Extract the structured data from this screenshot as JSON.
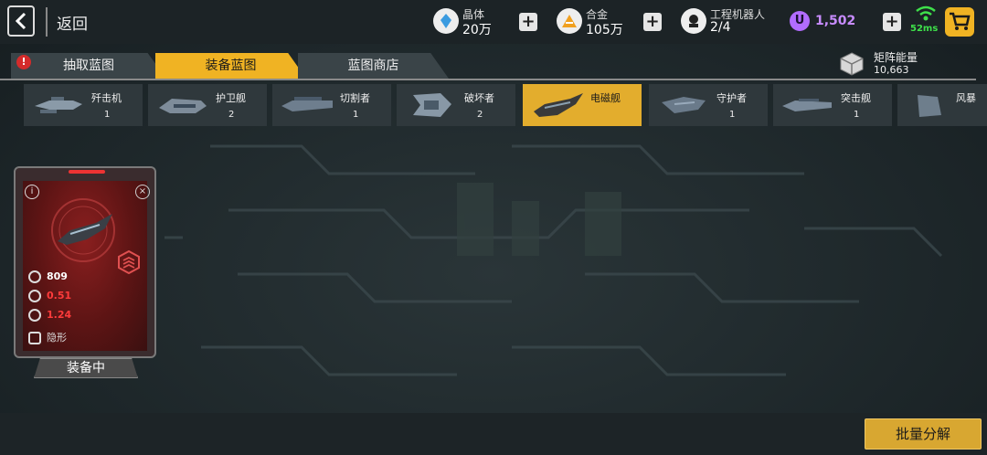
{
  "header": {
    "back_label": "返回",
    "resources": [
      {
        "label": "晶体",
        "value": "20万",
        "icon": "crystal-icon"
      },
      {
        "label": "合金",
        "value": "105万",
        "icon": "alloy-icon"
      },
      {
        "label": "工程机器人",
        "value": "2/4",
        "icon": "robot-icon"
      }
    ],
    "currency_value": "1,502",
    "network_latency": "52ms"
  },
  "tabs": [
    {
      "label": "抽取蓝图",
      "active": false,
      "alert": "!"
    },
    {
      "label": "装备蓝图",
      "active": true
    },
    {
      "label": "蓝图商店",
      "active": false
    }
  ],
  "matrix_energy": {
    "label": "矩阵能量",
    "value": "10,663"
  },
  "ships": [
    {
      "name": "歼击机",
      "count": "1"
    },
    {
      "name": "护卫舰",
      "count": "2"
    },
    {
      "name": "切割者",
      "count": "1"
    },
    {
      "name": "破坏者",
      "count": "2"
    },
    {
      "name": "电磁舰",
      "count": "",
      "selected": true
    },
    {
      "name": "守护者",
      "count": "1"
    },
    {
      "name": "突击舰",
      "count": "1"
    },
    {
      "name": "风暴",
      "count": ""
    }
  ],
  "card": {
    "stats": [
      {
        "icon": "cluster-icon",
        "value": "809",
        "color": "#ffffff"
      },
      {
        "icon": "speed-icon",
        "value": "0.51",
        "color": "#ff3b3b"
      },
      {
        "icon": "crosshair-icon",
        "value": "1.24",
        "color": "#ff3b3b"
      },
      {
        "icon": "stealth-icon",
        "value": "隐形",
        "color": "#dddddd"
      }
    ],
    "equip_label": "装备中"
  },
  "footer": {
    "batch_label": "批量分解"
  },
  "colors": {
    "accent": "#e3ad2d",
    "currency": "#b26cff",
    "wifi": "#3ee04a",
    "card_red": "#8a1f1f"
  }
}
